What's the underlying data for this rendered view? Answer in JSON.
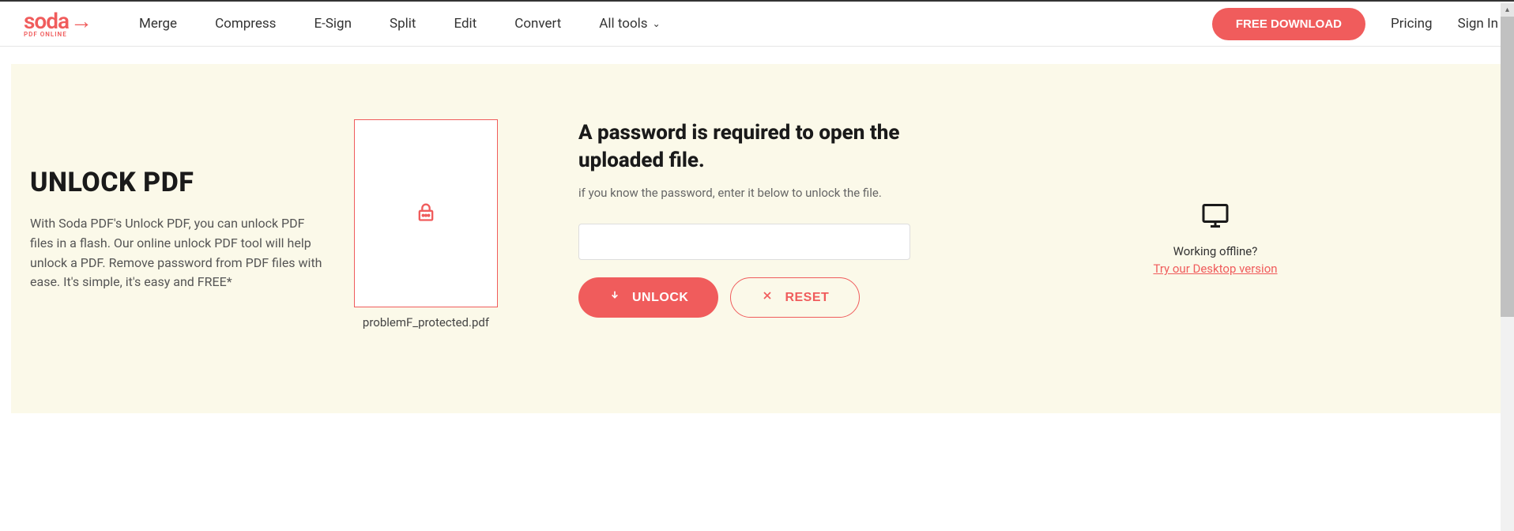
{
  "logo": {
    "text": "soda",
    "sub": "PDF ONLINE"
  },
  "nav": {
    "merge": "Merge",
    "compress": "Compress",
    "esign": "E-Sign",
    "split": "Split",
    "edit": "Edit",
    "convert": "Convert",
    "alltools": "All tools"
  },
  "header": {
    "free_download": "FREE DOWNLOAD",
    "pricing": "Pricing",
    "signin": "Sign In"
  },
  "left": {
    "title": "UNLOCK PDF",
    "desc": "With Soda PDF's Unlock PDF, you can unlock PDF files in a flash. Our online unlock PDF tool will help unlock a PDF. Remove password from PDF files with ease. It's simple, it's easy and FREE*"
  },
  "file": {
    "name": "problemF_protected.pdf"
  },
  "form": {
    "title": "A password is required to open the uploaded file.",
    "subtitle": "if you know the password, enter it below to unlock the file.",
    "unlock_label": "UNLOCK",
    "reset_label": "RESET",
    "password_value": ""
  },
  "offline": {
    "question": "Working offline?",
    "link": "Try our Desktop version"
  }
}
